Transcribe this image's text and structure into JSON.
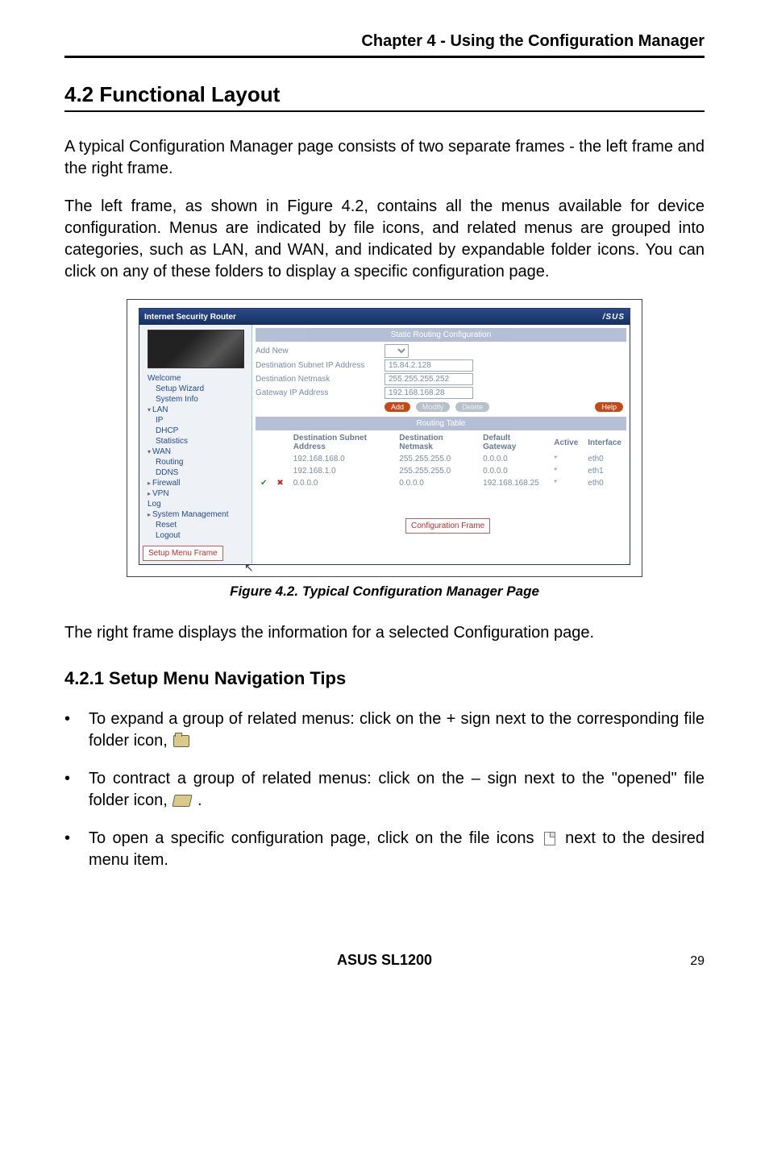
{
  "chapter_header": "Chapter 4 - Using the Configuration Manager",
  "section_title": "4.2 Functional Layout",
  "para1": "A typical Configuration Manager page consists of two separate frames - the left frame and the right frame.",
  "para2": "The left frame, as shown in Figure 4.2, contains all the menus available for device configuration. Menus are indicated by file icons, and related menus are grouped into categories, such as LAN, and WAN, and indicated by expandable folder icons. You can click on any of these folders to display a specific configuration page.",
  "figure": {
    "window_title": "Internet Security Router",
    "brand": "/SUS",
    "banner1": "Static Routing Configuration",
    "form": {
      "addnew_label": "Add New",
      "row1_label": "Destination Subnet IP Address",
      "row1_value": "15.84.2.128",
      "row2_label": "Destination Netmask",
      "row2_value": "255.255.255.252",
      "row3_label": "Gateway IP Address",
      "row3_value": "192.168.168.28"
    },
    "buttons": {
      "add": "Add",
      "modify": "Modify",
      "delete": "Delete",
      "help": "Help"
    },
    "banner2": "Routing Table",
    "table": {
      "headers": [
        "",
        "",
        "Destination Subnet Address",
        "Destination Netmask",
        "Default Gateway",
        "Active",
        "Interface"
      ],
      "rows": [
        [
          "",
          "",
          "192.168.168.0",
          "255.255.255.0",
          "0.0.0.0",
          "*",
          "eth0"
        ],
        [
          "",
          "",
          "192.168.1.0",
          "255.255.255.0",
          "0.0.0.0",
          "*",
          "eth1"
        ],
        [
          "✔",
          "✖",
          "0.0.0.0",
          "0.0.0.0",
          "192.168.168.25",
          "*",
          "eth0"
        ]
      ]
    },
    "nav": {
      "welcome": "Welcome",
      "setup_wizard": "Setup Wizard",
      "system_info": "System Info",
      "lan": "LAN",
      "ip": "IP",
      "dhcp": "DHCP",
      "statistics": "Statistics",
      "wan": "WAN",
      "routing": "Routing",
      "ddns": "DDNS",
      "firewall": "Firewall",
      "vpn": "VPN",
      "log": "Log",
      "system_mgmt": "System Management",
      "reset": "Reset",
      "logout": "Logout"
    },
    "setup_frame_label": "Setup Menu Frame",
    "config_frame_label": "Configuration Frame",
    "caption": "Figure 4.2. Typical Configuration Manager Page"
  },
  "para3": "The right frame displays the information for a selected Configuration page.",
  "subsection_title": "4.2.1 Setup Menu Navigation Tips",
  "tips": {
    "t1a": "To expand a group of related menus: click on the + sign next to the corresponding file folder icon, ",
    "t2a": "To contract a group of related menus: click on the – sign next to the \"opened\" file folder icon, ",
    "t2b": " .",
    "t3a": "To open a specific configuration page, click on the file icons ",
    "t3b": " next to the desired menu item."
  },
  "footer": {
    "product": "ASUS SL1200",
    "page": "29"
  }
}
